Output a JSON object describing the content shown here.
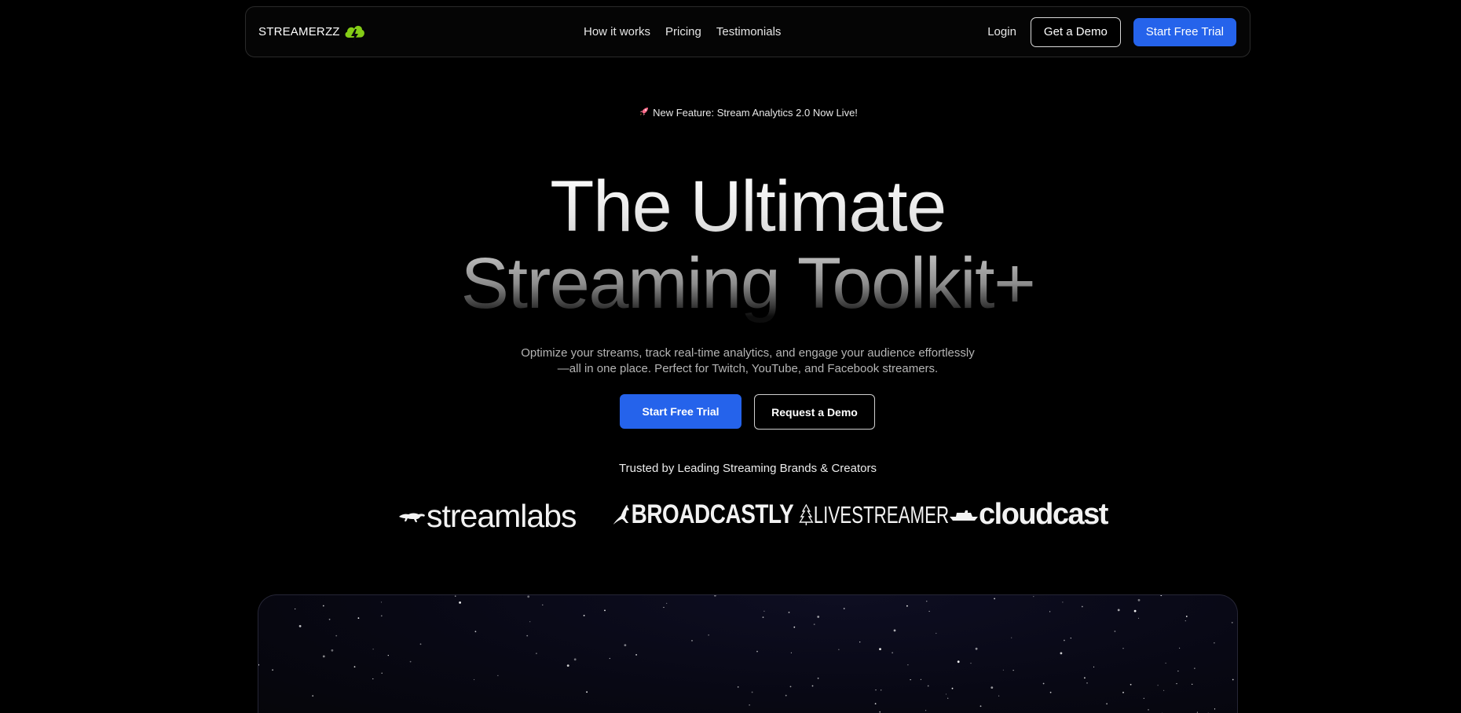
{
  "brand": {
    "name": "STREAMERZZ",
    "accent": "#84cc16"
  },
  "nav": {
    "links": [
      "How it works",
      "Pricing",
      "Testimonials"
    ],
    "login": "Login",
    "demo": "Get a Demo",
    "trial": "Start Free Trial"
  },
  "announcement": {
    "icon": "rocket-icon",
    "text": "New Feature: Stream Analytics 2.0 Now Live!"
  },
  "hero": {
    "line1": "The Ultimate",
    "line2": "Streaming Toolkit+",
    "subtitle": "Optimize your streams, track real-time analytics, and engage your audience effortlessly—all in one place. Perfect for Twitch, YouTube, and Facebook streamers.",
    "primary_cta": "Start Free Trial",
    "secondary_cta": "Request a Demo"
  },
  "trusted": {
    "heading": "Trusted by Leading Streaming Brands & Creators",
    "logos": [
      {
        "name": "streamlabs",
        "icon": "panther-icon"
      },
      {
        "name": "BROADCASTLY",
        "icon": "kangaroo-icon"
      },
      {
        "name": "LIVESTREAMER",
        "icon": "tree-icon"
      },
      {
        "name": "cloudcast",
        "icon": "ship-icon"
      }
    ]
  },
  "colors": {
    "primary": "#2563eb",
    "background": "#000000",
    "text_muted": "#b5b5b5"
  }
}
